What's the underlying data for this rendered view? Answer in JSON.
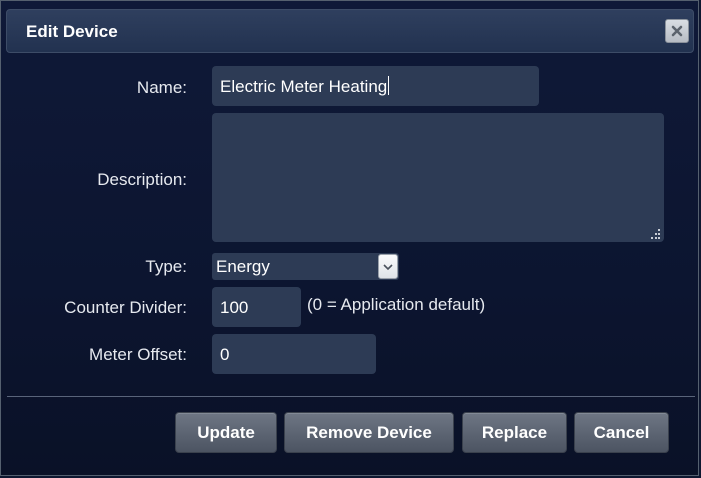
{
  "dialog": {
    "title": "Edit Device",
    "close_icon": "close-icon"
  },
  "form": {
    "name_label": "Name:",
    "name_value": "Electric Meter Heating",
    "description_label": "Description:",
    "description_value": "",
    "type_label": "Type:",
    "type_value": "Energy",
    "counter_divider_label": "Counter Divider:",
    "counter_divider_value": "100",
    "counter_divider_hint": "(0 = Application default)",
    "meter_offset_label": "Meter Offset:",
    "meter_offset_value": "0"
  },
  "buttons": {
    "update": "Update",
    "remove_device": "Remove Device",
    "replace": "Replace",
    "cancel": "Cancel"
  },
  "colors": {
    "background": "#0e1730",
    "input_bg": "#2d3b55",
    "titlebar": "#2a3957",
    "button": "#5d6573"
  }
}
